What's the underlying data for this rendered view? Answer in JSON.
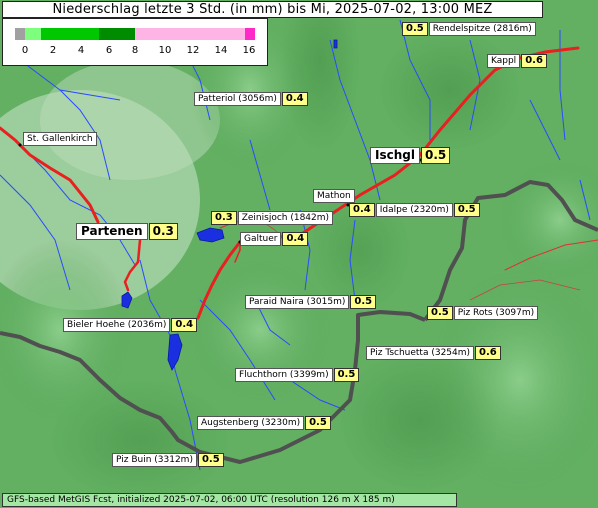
{
  "title": "Niederschlag letzte 3 Std. (in mm) bis Mi, 2025-07-02, 13:00 MEZ",
  "legend": {
    "ticks": [
      "0",
      "2",
      "4",
      "6",
      "8",
      "10",
      "12",
      "14",
      "16"
    ],
    "colors": {
      "zero": "#a0a0a0",
      "low": "#7dff7d",
      "mid": "#00c800",
      "high": "#008c00",
      "heavy": "#ffb4e6",
      "extreme": "#ff28c8"
    }
  },
  "places": [
    {
      "name": "Rendelspitze (2816m)",
      "value": "0.5"
    },
    {
      "name": "Kappl",
      "value": "0.6"
    },
    {
      "name": "Patteriol (3056m)",
      "value": "0.4"
    },
    {
      "name": "St. Gallenkirch",
      "value": ""
    },
    {
      "name": "Ischgl",
      "value": "0.5"
    },
    {
      "name": "Mathon",
      "value": ""
    },
    {
      "name": "Idalpe (2320m)",
      "value": "0.5",
      "value2": "0.4"
    },
    {
      "name": "Zeinisjoch (1842m)",
      "value": "0.3"
    },
    {
      "name": "Partenen",
      "value": "0.3"
    },
    {
      "name": "Galtuer",
      "value": "0.4"
    },
    {
      "name": "Paraid Naira (3015m)",
      "value": "0.5"
    },
    {
      "name": "Piz Rots (3097m)",
      "value": "0.5"
    },
    {
      "name": "Bieler Hoehe (2036m)",
      "value": "0.4"
    },
    {
      "name": "Piz Tschuetta (3254m)",
      "value": "0.6"
    },
    {
      "name": "Fluchthorn (3399m)",
      "value": "0.5"
    },
    {
      "name": "Augstenberg (3230m)",
      "value": "0.5"
    },
    {
      "name": "Piz Buin (3312m)",
      "value": "0.5"
    }
  ],
  "footer": "GFS-based MetGIS Fcst, initialized 2025-07-02, 06:00 UTC  (resolution 126 m X 185 m)"
}
